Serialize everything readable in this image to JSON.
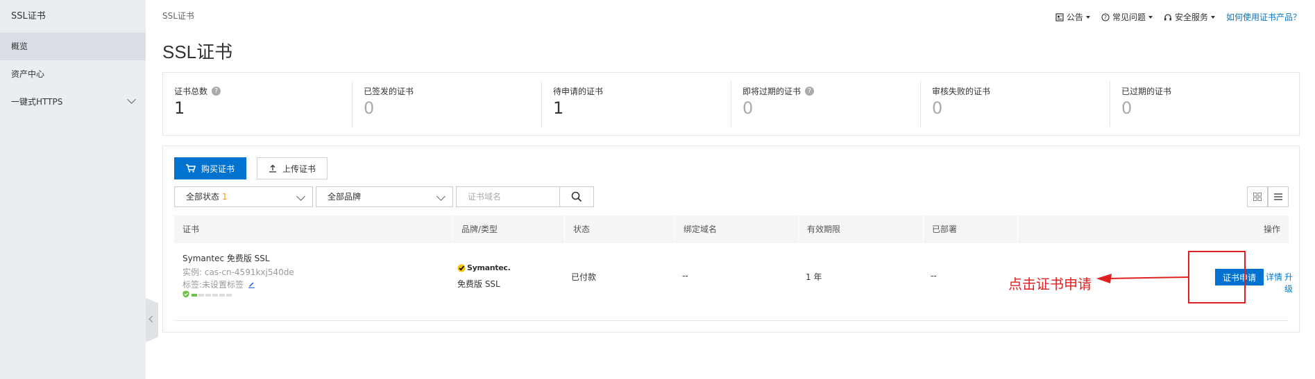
{
  "sidebar": {
    "title": "SSL证书",
    "items": [
      {
        "label": "概览",
        "active": true
      },
      {
        "label": "资产中心",
        "active": false
      },
      {
        "label": "一键式HTTPS",
        "active": false
      }
    ]
  },
  "breadcrumb": "SSL证书",
  "page_title": "SSL证书",
  "top_links": {
    "announcement": "公告",
    "faq": "常见问题",
    "security": "安全服务",
    "howto": "如何使用证书产品？"
  },
  "stats": [
    {
      "label": "证书总数",
      "value": "1",
      "help": true
    },
    {
      "label": "已签发的证书",
      "value": "0",
      "help": false
    },
    {
      "label": "待申请的证书",
      "value": "1",
      "help": false
    },
    {
      "label": "即将过期的证书",
      "value": "0",
      "help": true
    },
    {
      "label": "审核失败的证书",
      "value": "0",
      "help": false
    },
    {
      "label": "已过期的证书",
      "value": "0",
      "help": false
    }
  ],
  "toolbar": {
    "buy_label": "购买证书",
    "upload_label": "上传证书",
    "status_filter": "全部状态",
    "status_count": "1",
    "brand_filter": "全部品牌",
    "search_placeholder": "证书域名"
  },
  "table": {
    "headers": [
      "证书",
      "品牌/类型",
      "状态",
      "绑定域名",
      "有效期限",
      "已部署",
      "操作"
    ],
    "rows": [
      {
        "name": "Symantec 免费版 SSL",
        "instance": "实例: cas-cn-4591kxj540de",
        "tag": "标签:未设置标签",
        "brand_logo": "Symantec.",
        "type": "免费版 SSL",
        "status": "已付款",
        "domain": "--",
        "validity": "1 年",
        "deployed": "--",
        "actions": {
          "apply": "证书申请",
          "detail": "详情",
          "upgrade": "升级"
        }
      }
    ]
  },
  "annotation": "点击证书申请",
  "colors": {
    "primary": "#0073d1",
    "annotation": "#e02020",
    "sidebar": "#eaedf1"
  }
}
